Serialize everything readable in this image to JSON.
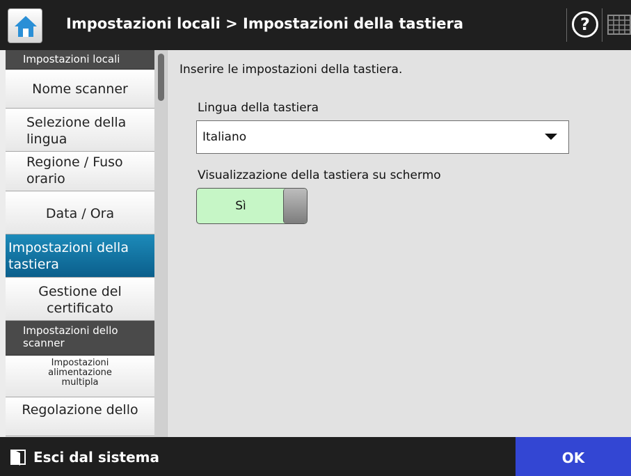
{
  "header": {
    "title": "Impostazioni locali > Impostazioni della tastiera",
    "home_icon": "home-icon",
    "help_symbol": "?",
    "keyboard_icon": "keyboard-icon"
  },
  "sidebar": {
    "items": [
      {
        "type": "section",
        "label": "Impostazioni locali"
      },
      {
        "type": "item",
        "label": "Nome scanner"
      },
      {
        "type": "item",
        "label": "Selezione della lingua"
      },
      {
        "type": "item",
        "label": "Regione / Fuso orario"
      },
      {
        "type": "item",
        "label": "Data / Ora"
      },
      {
        "type": "item",
        "label": "Impostazioni della tastiera",
        "active": true
      },
      {
        "type": "item",
        "label": "Gestione del certificato"
      },
      {
        "type": "section",
        "label": "Impostazioni dello scanner"
      },
      {
        "type": "item",
        "label": "Impostazioni alimentazione multipla"
      },
      {
        "type": "item",
        "label": "Regolazione dello"
      }
    ]
  },
  "main": {
    "instruction": "Inserire le impostazioni della tastiera.",
    "keyboard_language_label": "Lingua della tastiera",
    "keyboard_language_value": "Italiano",
    "onscreen_keyboard_label": "Visualizzazione della tastiera su schermo",
    "onscreen_keyboard_toggle": "Sì"
  },
  "footer": {
    "logout_label": "Esci dal sistema",
    "ok_label": "OK"
  },
  "colors": {
    "active_item": "#1477a6",
    "ok_button": "#3346d3",
    "toggle_on": "#c6f6c6"
  }
}
